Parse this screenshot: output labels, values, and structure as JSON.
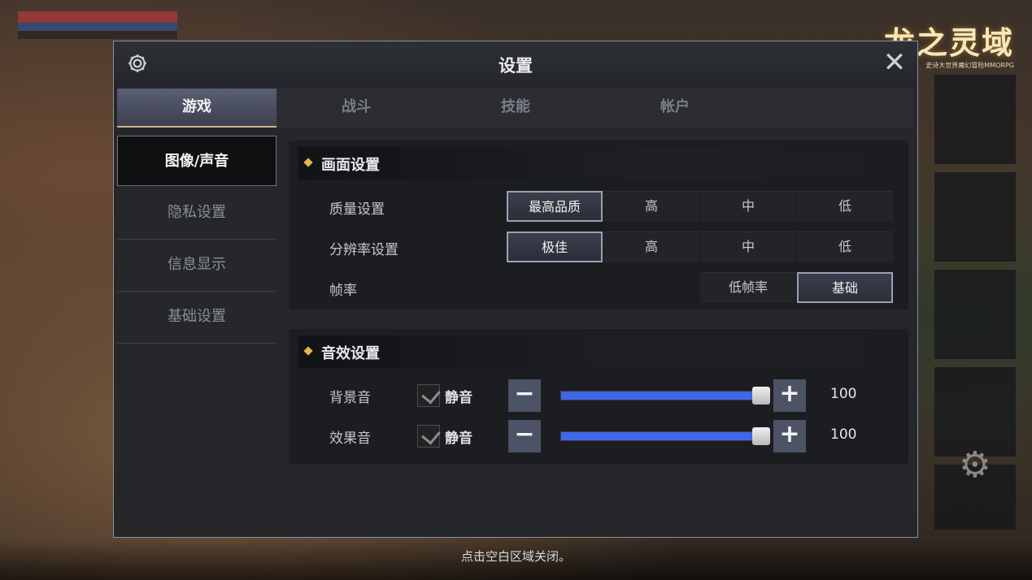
{
  "logo": {
    "title": "龙之灵域",
    "subtitle": "史诗大世界魔幻冒险MMORPG"
  },
  "dialog": {
    "title": "设置",
    "close_symbol": "✕",
    "icons": {
      "settings": "gear-icon",
      "close": "close-icon"
    }
  },
  "tabs": [
    {
      "label": "游戏",
      "active": true
    },
    {
      "label": "战斗",
      "active": false
    },
    {
      "label": "技能",
      "active": false
    },
    {
      "label": "帐户",
      "active": false
    }
  ],
  "sidebar": [
    {
      "label": "图像/声音",
      "active": true
    },
    {
      "label": "隐私设置",
      "active": false
    },
    {
      "label": "信息显示",
      "active": false
    },
    {
      "label": "基础设置",
      "active": false
    }
  ],
  "graphics": {
    "title": "画面设置",
    "quality": {
      "label": "质量设置",
      "options": [
        "最高品质",
        "高",
        "中",
        "低"
      ],
      "selected": "最高品质"
    },
    "resolution": {
      "label": "分辨率设置",
      "options": [
        "极佳",
        "高",
        "中",
        "低"
      ],
      "selected": "极佳"
    },
    "framerate": {
      "label": "帧率",
      "options": [
        "低帧率",
        "基础"
      ],
      "selected": "基础"
    }
  },
  "sound": {
    "title": "音效设置",
    "mute_label": "静音",
    "minus": "−",
    "plus": "+",
    "bgm": {
      "label": "背景音",
      "muted": false,
      "value": 100,
      "value_text": "100"
    },
    "sfx": {
      "label": "效果音",
      "muted": false,
      "value": 100,
      "value_text": "100"
    }
  },
  "footer_hint": "点击空白区域关闭。",
  "colors": {
    "accent_gold": "#e3b64a",
    "slider_fill": "#3f67e8",
    "selected_border": "#9aa1b4"
  }
}
